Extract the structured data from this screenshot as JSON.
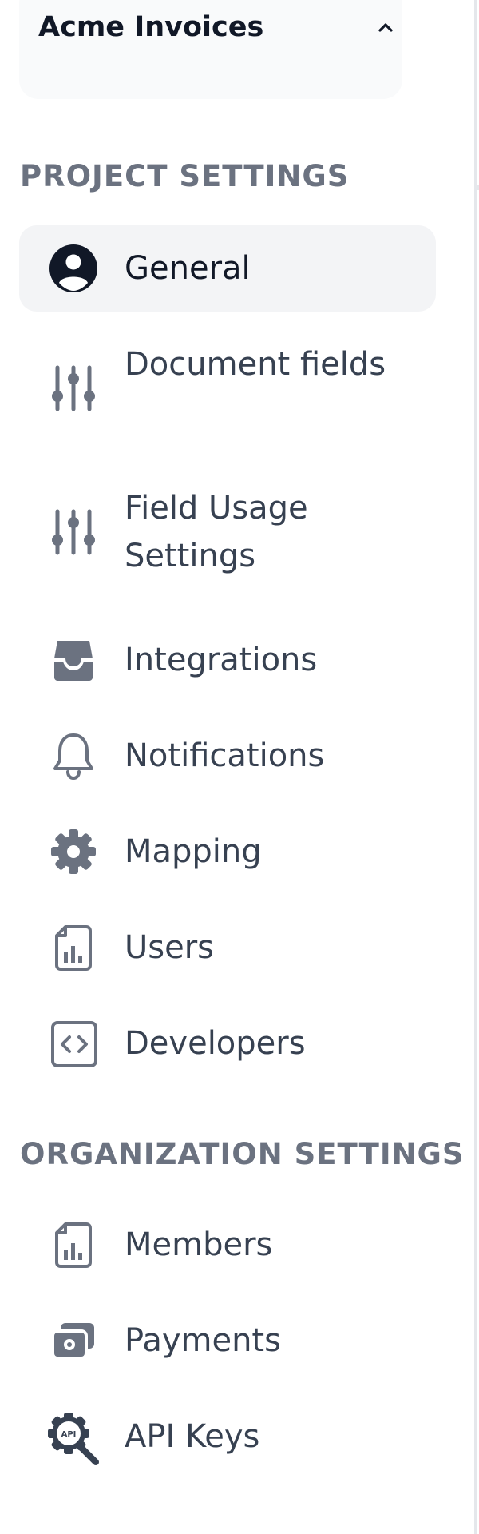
{
  "project": {
    "name": "Acme Invoices"
  },
  "sections": {
    "project_settings": "PROJECT SETTINGS",
    "organization_settings": "ORGANIZATION SETTINGS"
  },
  "nav": {
    "general": {
      "label": "General",
      "icon": "user-circle-icon",
      "active": true
    },
    "document_fields": {
      "label": "Document fields",
      "icon": "sliders-icon"
    },
    "field_usage": {
      "label": "Field Usage Settings",
      "icon": "sliders-icon"
    },
    "integrations": {
      "label": "Integrations",
      "icon": "inbox-tray-icon"
    },
    "notifications": {
      "label": "Notifications",
      "icon": "bell-icon"
    },
    "mapping": {
      "label": "Mapping",
      "icon": "gear-icon"
    },
    "users": {
      "label": "Users",
      "icon": "document-chart-icon"
    },
    "developers": {
      "label": "Developers",
      "icon": "code-icon"
    },
    "members": {
      "label": "Members",
      "icon": "document-chart-icon"
    },
    "payments": {
      "label": "Payments",
      "icon": "cash-icon"
    },
    "api_keys": {
      "label": "API Keys",
      "icon": "api-key-icon"
    }
  },
  "colors": {
    "active_bg": "#f3f4f6",
    "icon": "#6b7280",
    "active_icon": "#111827",
    "section_label": "#6b7280"
  }
}
